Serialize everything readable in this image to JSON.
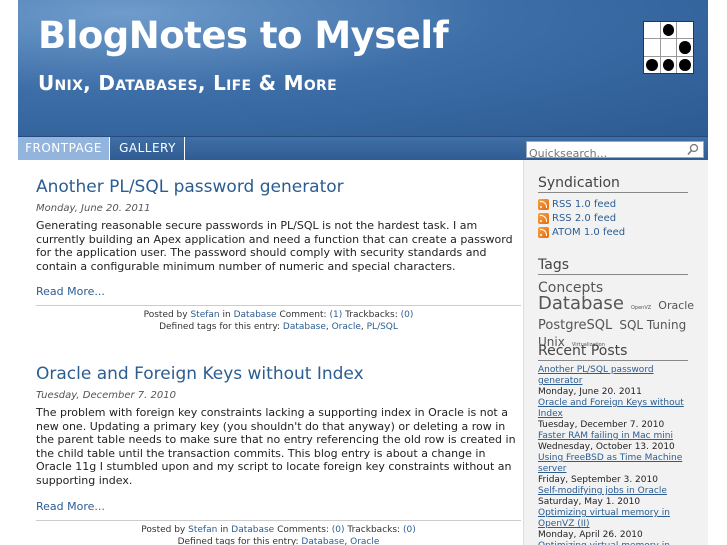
{
  "site": {
    "title": "BlogNotes to Myself",
    "tagline": "Unix, Databases, Life & More"
  },
  "nav": {
    "tabs": [
      {
        "label": "FRONTPAGE",
        "active": true
      },
      {
        "label": "GALLERY",
        "active": false
      }
    ],
    "search_placeholder": "Quicksearch..."
  },
  "posts": [
    {
      "title": "Another PL/SQL password generator",
      "date": "Monday, June 20. 2011",
      "body": "Generating reasonable secure passwords in PL/SQL is not the hardest task. I am currently building an Apex application and need a function that can create a password for the application user. The password should comply with security standards and contain a configurable minimum number of numeric and special characters.",
      "read_more": "Read More...",
      "posted_by": "Posted by",
      "author": "Stefan",
      "in": "in",
      "category": "Database",
      "comment_label": "Comment:",
      "comment_count": "(1)",
      "trackback_label": "Trackbacks:",
      "trackback_count": "(0)",
      "tags_label": "Defined tags for this entry:",
      "tags": [
        "Database",
        "Oracle",
        "PL/SQL"
      ]
    },
    {
      "title": "Oracle and Foreign Keys without Index",
      "date": "Tuesday, December 7. 2010",
      "body": "The problem with foreign key constraints lacking a supporting index in Oracle is not a new one. Updating a primary key (you shouldn't do that anyway) or deleting a row in the parent table needs to make sure that no entry referencing the old row is created in the child table until the transaction commits. This blog entry is about a change in Oracle 11g I stumbled upon and my script to locate foreign key constraints without an supporting index.",
      "read_more": "Read More...",
      "posted_by": "Posted by",
      "author": "Stefan",
      "in": "in",
      "category": "Database",
      "comment_label": "Comments:",
      "comment_count": "(0)",
      "trackback_label": "Trackbacks:",
      "trackback_count": "(0)",
      "tags_label": "Defined tags for this entry:",
      "tags": [
        "Database",
        "Oracle"
      ]
    }
  ],
  "sidebar": {
    "syndication_title": "Syndication",
    "feeds": [
      "RSS 1.0 feed",
      "RSS 2.0 feed",
      "ATOM 1.0 feed"
    ],
    "tags_title": "Tags",
    "tag_cloud": [
      {
        "label": "Concepts",
        "size": 14
      },
      {
        "label": "Database",
        "size": 18
      },
      {
        "label": "OpenVZ",
        "size": 5
      },
      {
        "label": "Oracle",
        "size": 11
      },
      {
        "label": "PostgreSQL",
        "size": 13
      },
      {
        "label": "SQL Tuning",
        "size": 12
      },
      {
        "label": "Unix",
        "size": 12
      },
      {
        "label": "Virtualization",
        "size": 5
      }
    ],
    "recent_title": "Recent Posts",
    "recent": [
      {
        "title": "Another PL/SQL password generator",
        "date": "Monday, June 20. 2011"
      },
      {
        "title": "Oracle and Foreign Keys without Index",
        "date": "Tuesday, December 7. 2010"
      },
      {
        "title": "Faster RAM failing in Mac mini",
        "date": "Wednesday, October 13. 2010"
      },
      {
        "title": "Using FreeBSD as Time Machine server",
        "date": "Friday, September 3. 2010"
      },
      {
        "title": "Self-modifying jobs in Oracle",
        "date": "Saturday, May 1. 2010"
      },
      {
        "title": "Optimizing virtual memory in OpenVZ (II)",
        "date": "Monday, April 26. 2010"
      },
      {
        "title": "Optimizing virtual memory in",
        "date": ""
      }
    ]
  },
  "colors": {
    "header_blue": "#3d6ea7",
    "link_blue": "#2b5d93",
    "active_tab": "#93b5dd"
  }
}
